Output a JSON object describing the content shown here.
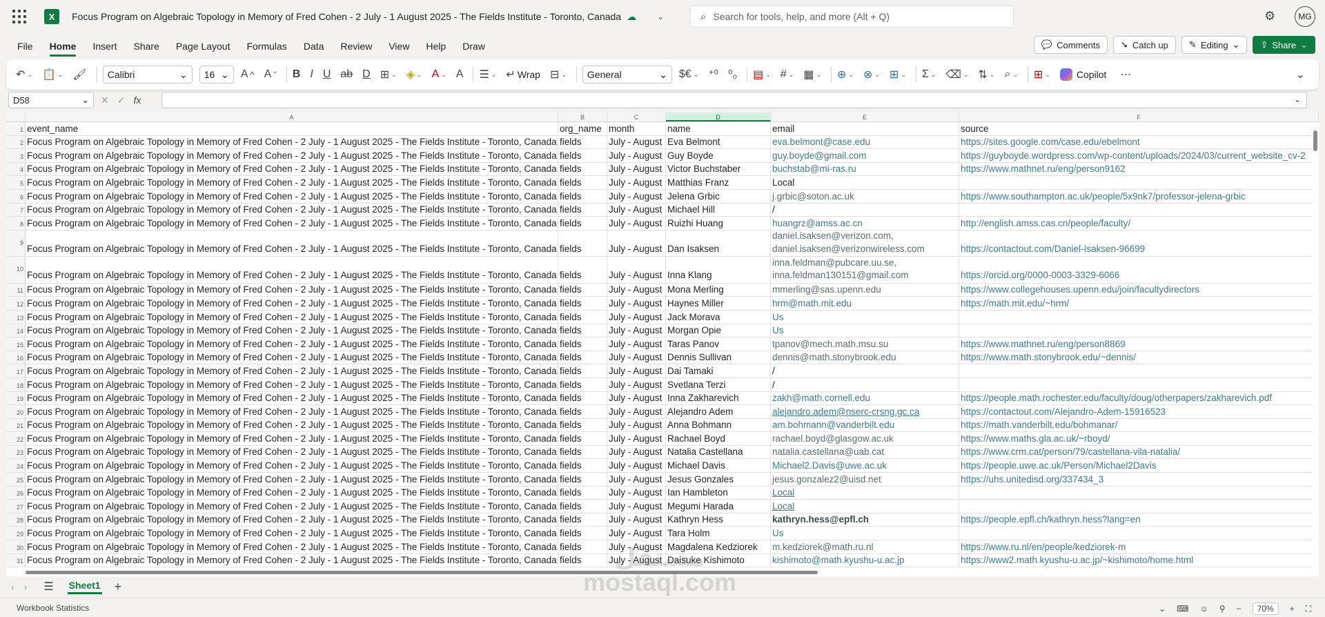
{
  "titlebar": {
    "doc_title": "Focus Program on Algebraic Topology in Memory of Fred Cohen - 2 July - 1 August 2025 - The Fields Institute - Toronto, Canada",
    "search_placeholder": "Search for tools, help, and more (Alt + Q)",
    "avatar_initials": "MG",
    "app_icon": "X"
  },
  "menu": {
    "items": [
      "File",
      "Home",
      "Insert",
      "Share",
      "Page Layout",
      "Formulas",
      "Data",
      "Review",
      "View",
      "Help",
      "Draw"
    ],
    "comments": "Comments",
    "catch_up": "Catch up",
    "editing": "Editing",
    "share": "Share"
  },
  "ribbon": {
    "font": "Calibri",
    "size": "16",
    "wrap": "Wrap",
    "number_format": "General",
    "copilot": "Copilot"
  },
  "formula": {
    "name_box": "D58",
    "fx": "fx",
    "content": ""
  },
  "columns": [
    "A",
    "B",
    "C",
    "D",
    "E",
    "F"
  ],
  "rows": [
    {
      "n": "1",
      "a": "event_name",
      "b": "org_name",
      "c": "month",
      "d": "name",
      "e": "email",
      "f": "source"
    },
    {
      "n": "2",
      "a": "Focus Program on Algebraic Topology in Memory of Fred Cohen - 2 July - 1 August 2025 - The Fields Institute - Toronto, Canada",
      "b": "fields",
      "c": "July - August",
      "d": "Eva Belmont",
      "e": "eva.belmont@case.edu",
      "f": "https://sites.google.com/case.edu/ebelmont"
    },
    {
      "n": "3",
      "a": "Focus Program on Algebraic Topology in Memory of Fred Cohen - 2 July - 1 August 2025 - The Fields Institute - Toronto, Canada",
      "b": "fields",
      "c": "July - August",
      "d": "Guy Boyde",
      "e": "guy.boyde@gmail.com",
      "f": "https://guyboyde.wordpress.com/wp-content/uploads/2024/03/current_website_cv-2"
    },
    {
      "n": "4",
      "a": "Focus Program on Algebraic Topology in Memory of Fred Cohen - 2 July - 1 August 2025 - The Fields Institute - Toronto, Canada",
      "b": "fields",
      "c": "July - August",
      "d": "Victor Buchstaber",
      "e": "buchstab@mi-ras.ru",
      "f": "https://www.mathnet.ru/eng/person9162"
    },
    {
      "n": "5",
      "a": "Focus Program on Algebraic Topology in Memory of Fred Cohen - 2 July - 1 August 2025 - The Fields Institute - Toronto, Canada",
      "b": "fields",
      "c": "July - August",
      "d": "Matthias Franz",
      "e": "Local",
      "f": ""
    },
    {
      "n": "6",
      "a": "Focus Program on Algebraic Topology in Memory of Fred Cohen - 2 July - 1 August 2025 - The Fields Institute - Toronto, Canada",
      "b": "fields",
      "c": "July - August",
      "d": "Jelena Grbic",
      "e": "j.grbic@soton.ac.uk",
      "f": "https://www.southampton.ac.uk/people/5x9nk7/professor-jelena-grbic"
    },
    {
      "n": "7",
      "a": "Focus Program on Algebraic Topology in Memory of Fred Cohen - 2 July - 1 August 2025 - The Fields Institute - Toronto, Canada",
      "b": "fields",
      "c": "July - August",
      "d": "Michael Hill",
      "e": "/",
      "f": ""
    },
    {
      "n": "8",
      "a": "Focus Program on Algebraic Topology in Memory of Fred Cohen - 2 July - 1 August 2025 - The Fields Institute - Toronto, Canada",
      "b": "fields",
      "c": "July - August",
      "d": "Ruizhi Huang",
      "e": "huangrz@amss.ac.cn",
      "f": "http://english.amss.cas.cn/people/faculty/"
    },
    {
      "n": "9",
      "a": "Focus Program on Algebraic Topology in Memory of Fred Cohen - 2 July - 1 August 2025 - The Fields Institute - Toronto, Canada",
      "b": "fields",
      "c": "July - August",
      "d": "Dan Isaksen",
      "e": "daniel.isaksen@verizon.com, daniel.isaksen@verizonwireless.com",
      "f": "https://contactout.com/Daniel-Isaksen-96699"
    },
    {
      "n": "10",
      "a": "Focus Program on Algebraic Topology in Memory of Fred Cohen - 2 July - 1 August 2025 - The Fields Institute - Toronto, Canada",
      "b": "fields",
      "c": "July - August",
      "d": "Inna Klang",
      "e": "inna.feldman@pubcare.uu.se, inna.feldman130151@gmail.com",
      "f": "https://orcid.org/0000-0003-3329-6066"
    },
    {
      "n": "11",
      "a": "Focus Program on Algebraic Topology in Memory of Fred Cohen - 2 July - 1 August 2025 - The Fields Institute - Toronto, Canada",
      "b": "fields",
      "c": "July - August",
      "d": "Mona Merling",
      "e": "mmerling@sas.upenn.edu",
      "f": "https://www.collegehouses.upenn.edu/join/facultydirectors"
    },
    {
      "n": "12",
      "a": "Focus Program on Algebraic Topology in Memory of Fred Cohen - 2 July - 1 August 2025 - The Fields Institute - Toronto, Canada",
      "b": "fields",
      "c": "July - August",
      "d": "Haynes Miller",
      "e": "hrm@math.mit.edu",
      "f": "https://math.mit.edu/~hrm/"
    },
    {
      "n": "13",
      "a": "Focus Program on Algebraic Topology in Memory of Fred Cohen - 2 July - 1 August 2025 - The Fields Institute - Toronto, Canada",
      "b": "fields",
      "c": "July - August",
      "d": "Jack Morava",
      "e": "Us",
      "f": ""
    },
    {
      "n": "14",
      "a": "Focus Program on Algebraic Topology in Memory of Fred Cohen - 2 July - 1 August 2025 - The Fields Institute - Toronto, Canada",
      "b": "fields",
      "c": "July - August",
      "d": "Morgan Opie",
      "e": "Us",
      "f": ""
    },
    {
      "n": "15",
      "a": "Focus Program on Algebraic Topology in Memory of Fred Cohen - 2 July - 1 August 2025 - The Fields Institute - Toronto, Canada",
      "b": "fields",
      "c": "July - August",
      "d": "Taras Panov",
      "e": "tpanov@mech.math.msu.su",
      "f": "https://www.mathnet.ru/eng/person8869"
    },
    {
      "n": "16",
      "a": "Focus Program on Algebraic Topology in Memory of Fred Cohen - 2 July - 1 August 2025 - The Fields Institute - Toronto, Canada",
      "b": "fields",
      "c": "July - August",
      "d": "Dennis Sullivan",
      "e": "dennis@math.stonybrook.edu",
      "f": "https://www.math.stonybrook.edu/~dennis/"
    },
    {
      "n": "17",
      "a": "Focus Program on Algebraic Topology in Memory of Fred Cohen - 2 July - 1 August 2025 - The Fields Institute - Toronto, Canada",
      "b": "fields",
      "c": "July - August",
      "d": "Dai Tamaki",
      "e": "/",
      "f": ""
    },
    {
      "n": "18",
      "a": "Focus Program on Algebraic Topology in Memory of Fred Cohen - 2 July - 1 August 2025 - The Fields Institute - Toronto, Canada",
      "b": "fields",
      "c": "July - August",
      "d": "Svetlana Terzi",
      "e": "/",
      "f": ""
    },
    {
      "n": "19",
      "a": "Focus Program on Algebraic Topology in Memory of Fred Cohen - 2 July - 1 August 2025 - The Fields Institute - Toronto, Canada",
      "b": "fields",
      "c": "July - August",
      "d": "Inna Zakharevich",
      "e": "zakh@math.cornell.edu",
      "f": "https://people.math.rochester.edu/faculty/doug/otherpapers/zakharevich.pdf"
    },
    {
      "n": "20",
      "a": "Focus Program on Algebraic Topology in Memory of Fred Cohen - 2 July - 1 August 2025 - The Fields Institute - Toronto, Canada",
      "b": "fields",
      "c": "July - August",
      "d": "Alejandro Adem",
      "e": "alejandro.adem@nserc-crsng.gc.ca",
      "f": "https://contactout.com/Alejandro-Adem-15916523"
    },
    {
      "n": "21",
      "a": "Focus Program on Algebraic Topology in Memory of Fred Cohen - 2 July - 1 August 2025 - The Fields Institute - Toronto, Canada",
      "b": "fields",
      "c": "July - August",
      "d": "Anna Bohmann",
      "e": "am.bohmann@vanderbilt.edu",
      "f": "https://math.vanderbilt.edu/bohmanar/"
    },
    {
      "n": "22",
      "a": "Focus Program on Algebraic Topology in Memory of Fred Cohen - 2 July - 1 August 2025 - The Fields Institute - Toronto, Canada",
      "b": "fields",
      "c": "July - August",
      "d": "Rachael Boyd",
      "e": "rachael.boyd@glasgow.ac.uk",
      "f": "https://www.maths.gla.ac.uk/~rboyd/"
    },
    {
      "n": "23",
      "a": "Focus Program on Algebraic Topology in Memory of Fred Cohen - 2 July - 1 August 2025 - The Fields Institute - Toronto, Canada",
      "b": "fields",
      "c": "July - August",
      "d": "Natalia Castellana",
      "e": "natalia.castellana@uab.cat",
      "f": "https://www.crm.cat/person/79/castellana-vila-natalia/"
    },
    {
      "n": "24",
      "a": "Focus Program on Algebraic Topology in Memory of Fred Cohen - 2 July - 1 August 2025 - The Fields Institute - Toronto, Canada",
      "b": "fields",
      "c": "July - August",
      "d": "Michael Davis",
      "e": "Michael2.Davis@uwe.ac.uk",
      "f": "https://people.uwe.ac.uk/Person/Michael2Davis"
    },
    {
      "n": "25",
      "a": "Focus Program on Algebraic Topology in Memory of Fred Cohen - 2 July - 1 August 2025 - The Fields Institute - Toronto, Canada",
      "b": "fields",
      "c": "July - August",
      "d": "Jesus Gonzales",
      "e": "jesus.gonzalez2@uisd.net",
      "f": "https://uhs.unitedisd.org/337434_3"
    },
    {
      "n": "26",
      "a": "Focus Program on Algebraic Topology in Memory of Fred Cohen - 2 July - 1 August 2025 - The Fields Institute - Toronto, Canada",
      "b": "fields",
      "c": "July - August",
      "d": "Ian Hambleton",
      "e": "Local",
      "f": ""
    },
    {
      "n": "27",
      "a": "Focus Program on Algebraic Topology in Memory of Fred Cohen - 2 July - 1 August 2025 - The Fields Institute - Toronto, Canada",
      "b": "fields",
      "c": "July - August",
      "d": "Megumi Harada",
      "e": "Local",
      "f": ""
    },
    {
      "n": "28",
      "a": "Focus Program on Algebraic Topology in Memory of Fred Cohen - 2 July - 1 August 2025 - The Fields Institute - Toronto, Canada",
      "b": "fields",
      "c": "July - August",
      "d": "Kathryn Hess",
      "e": "kathryn.hess@epfl.ch",
      "f": "https://people.epfl.ch/kathryn.hess?lang=en"
    },
    {
      "n": "29",
      "a": "Focus Program on Algebraic Topology in Memory of Fred Cohen - 2 July - 1 August 2025 - The Fields Institute - Toronto, Canada",
      "b": "fields",
      "c": "July - August",
      "d": "Tara Holm",
      "e": "Us",
      "f": ""
    },
    {
      "n": "30",
      "a": "Focus Program on Algebraic Topology in Memory of Fred Cohen - 2 July - 1 August 2025 - The Fields Institute - Toronto, Canada",
      "b": "fields",
      "c": "July - August",
      "d": "Magdalena Kedziorek",
      "e": "m.kedziorek@math.ru.nl",
      "f": "https://www.ru.nl/en/people/kedziorek-m"
    },
    {
      "n": "31",
      "a": "Focus Program on Algebraic Topology in Memory of Fred Cohen - 2 July - 1 August 2025 - The Fields Institute - Toronto, Canada",
      "b": "fields",
      "c": "July - August",
      "d": "Daisuke Kishimoto",
      "e": "kishimoto@math.kyushu-u.ac.jp",
      "f": "https://www2.math.kyushu-u.ac.jp/~kishimoto/home.html"
    }
  ],
  "sheetbar": {
    "tab": "Sheet1"
  },
  "statusbar": {
    "left": "Workbook Statistics",
    "zoom": "70%"
  },
  "watermark": {
    "line1": "مستقل",
    "line2": "mostaql.com"
  }
}
